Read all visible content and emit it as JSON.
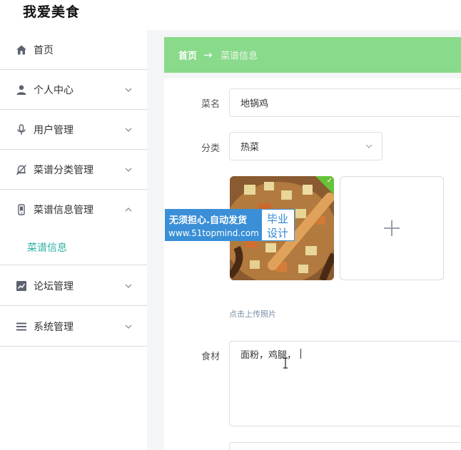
{
  "app": {
    "title": "我爱美食"
  },
  "sidebar": {
    "items": [
      {
        "label": "首页",
        "icon": "home-icon",
        "has_chevron": false
      },
      {
        "label": "个人中心",
        "icon": "user-icon",
        "has_chevron": true,
        "expanded": false
      },
      {
        "label": "用户管理",
        "icon": "microphone-icon",
        "has_chevron": true,
        "expanded": false
      },
      {
        "label": "菜谱分类管理",
        "icon": "bell-off-icon",
        "has_chevron": true,
        "expanded": false
      },
      {
        "label": "菜谱信息管理",
        "icon": "mobile-icon",
        "has_chevron": true,
        "expanded": true
      },
      {
        "label": "论坛管理",
        "icon": "trend-chart-icon",
        "has_chevron": true,
        "expanded": false
      },
      {
        "label": "系统管理",
        "icon": "list-icon",
        "has_chevron": true,
        "expanded": false
      }
    ],
    "subitem": {
      "label": "菜谱信息",
      "color": "#2bb3a3"
    }
  },
  "breadcrumb": {
    "home": "首页",
    "separator": "→",
    "current": "菜谱信息",
    "bar_color": "#89da8a"
  },
  "form": {
    "name_label": "菜名",
    "name_value": "地锅鸡",
    "category_label": "分类",
    "category_value": "热菜",
    "upload_hint": "点击上传照片",
    "ingredients_label": "食材",
    "ingredients_value": "面粉，鸡腿，"
  },
  "watermark": {
    "line1": "无须担心.自动发货",
    "line2": "www.51topmind.com",
    "right_top": "毕业",
    "right_bottom": "设计"
  }
}
